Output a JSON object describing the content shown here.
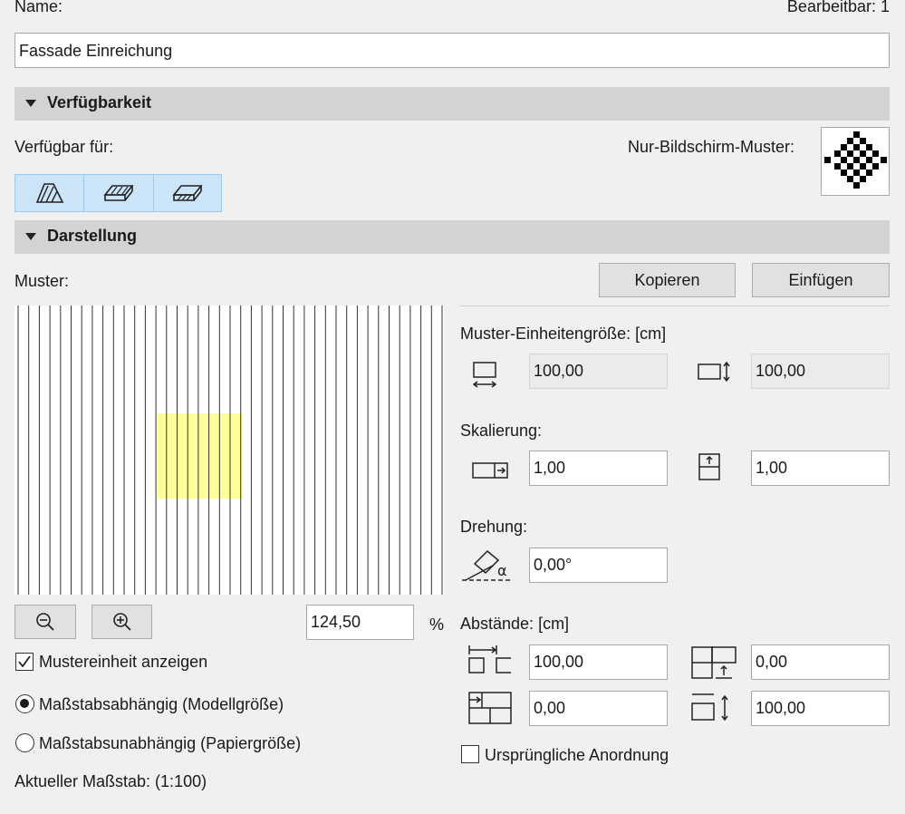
{
  "name_label": "Name:",
  "editable_label": "Bearbeitbar: 1",
  "name_value": "Fassade Einreichung",
  "sections": {
    "availability": "Verfügbarkeit",
    "display": "Darstellung"
  },
  "availability": {
    "available_for_label": "Verfügbar für:",
    "screen_pattern_label": "Nur-Bildschirm-Muster:",
    "toggles": [
      {
        "icon": "cut-fill-icon",
        "active": true
      },
      {
        "icon": "cover-fill-icon",
        "active": true
      },
      {
        "icon": "drafting-fill-icon",
        "active": true
      }
    ]
  },
  "display": {
    "pattern_label": "Muster:",
    "copy_label": "Kopieren",
    "paste_label": "Einfügen",
    "zoom_value": "124,50",
    "zoom_unit": "%",
    "show_unit_label": "Mustereinheit anzeigen",
    "show_unit_checked": true,
    "scale_dependent_label": "Maßstabsabhängig (Modellgröße)",
    "scale_independent_label": "Maßstabsunabhängig (Papiergröße)",
    "scale_mode": "dependent",
    "current_scale_label": "Aktueller Maßstab: (1:100)",
    "unit_size_label": "Muster-Einheitengröße: [cm]",
    "unit_width": "100,00",
    "unit_height": "100,00",
    "scaling_label": "Skalierung:",
    "scale_x": "1,00",
    "scale_y": "1,00",
    "rotation_label": "Drehung:",
    "rotation_value": "0,00°",
    "spacing_label": "Abstände: [cm]",
    "spacing_1": "100,00",
    "spacing_2": "0,00",
    "spacing_3": "0,00",
    "spacing_4": "100,00",
    "original_arrangement_label": "Ursprüngliche Anordnung",
    "original_arrangement_checked": false,
    "preview_highlight_color": "#ffff99"
  }
}
